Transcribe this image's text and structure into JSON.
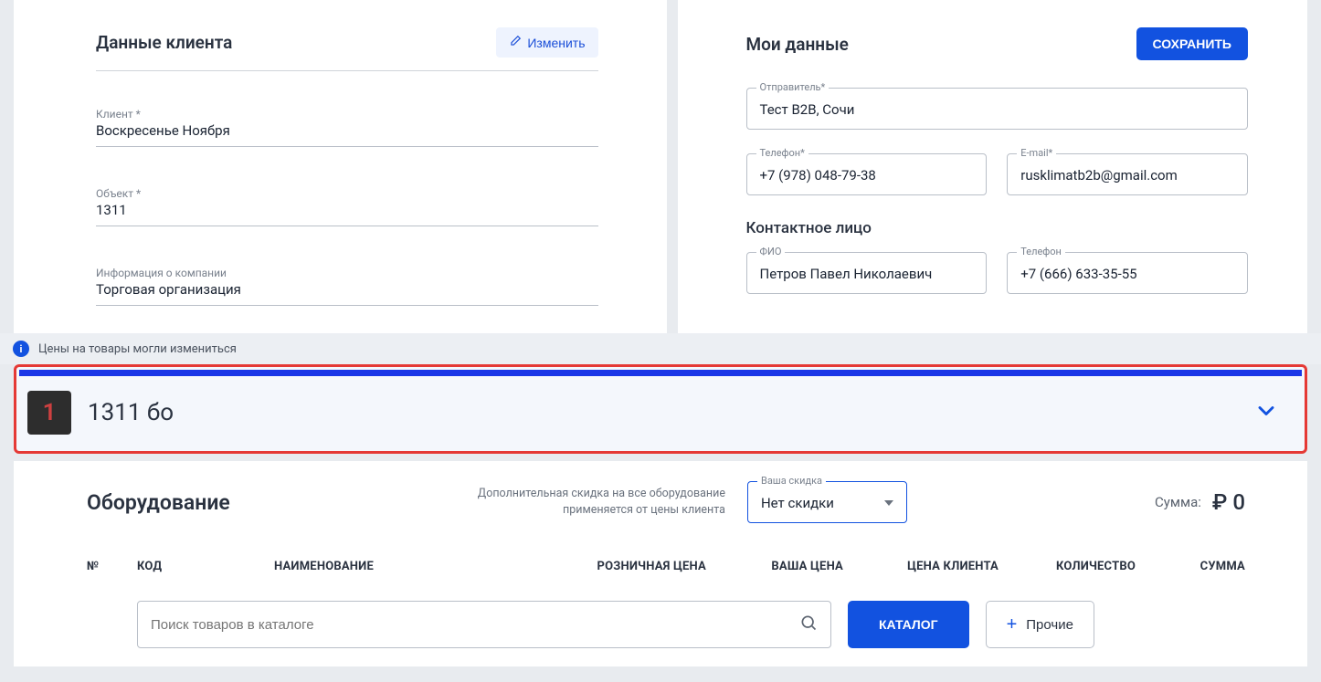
{
  "client": {
    "section_title": "Данные клиента",
    "edit_label": "Изменить",
    "fields": {
      "client_label": "Клиент *",
      "client_value": "Воскресенье Ноября",
      "object_label": "Объект *",
      "object_value": "1311",
      "company_label": "Информация о компании",
      "company_value": "Торговая организация"
    }
  },
  "my": {
    "section_title": "Мои данные",
    "save_label": "СОХРАНИТЬ",
    "sender_label": "Отправитель*",
    "sender_value": "Тест B2B, Сочи",
    "phone_label": "Телефон*",
    "phone_value": "+7 (978) 048-79-38",
    "email_label": "E-mail*",
    "email_value": "rusklimatb2b@gmail.com",
    "contact_header": "Контактное лицо",
    "fio_label": "ФИО",
    "fio_value": "Петров Павел Николаевич",
    "cphone_label": "Телефон",
    "cphone_value": "+7 (666) 633-35-55"
  },
  "info_bar": "Цены на товары могли измениться",
  "kp": {
    "badge": "1",
    "title": "1311 бо"
  },
  "equip": {
    "title": "Оборудование",
    "discount_note_l1": "Дополнительная скидка на все оборудование",
    "discount_note_l2": "применяется от цены клиента",
    "discount_label": "Ваша скидка",
    "discount_value": "Нет скидки",
    "sum_label": "Сумма:",
    "sum_value": "0",
    "headers": {
      "num": "№",
      "code": "КОД",
      "name": "НАИМЕНОВАНИЕ",
      "retail": "РОЗНИЧНАЯ ЦЕНА",
      "your": "ВАША ЦЕНА",
      "client": "ЦЕНА КЛИЕНТА",
      "qty": "КОЛИЧЕСТВО",
      "sum": "СУММА"
    },
    "search_placeholder": "Поиск товаров в каталоге",
    "catalog_btn": "КАТАЛОГ",
    "other_btn": "Прочие"
  }
}
